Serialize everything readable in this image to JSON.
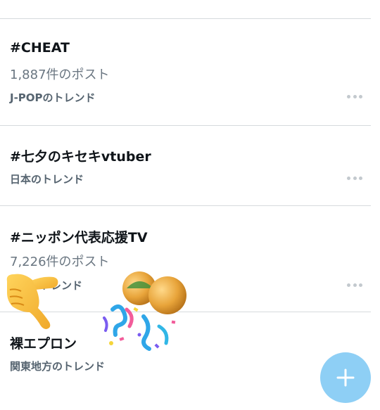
{
  "trends": [
    {
      "title": "#CHEAT",
      "count": "1,887件のポスト",
      "context": "J-POPのトレンド"
    },
    {
      "title": "#七夕のキセキvtuber",
      "count": "",
      "context": "日本のトレンド"
    },
    {
      "title": "#ニッポン代表応援TV",
      "count": "7,226件のポスト",
      "context": "トレンド"
    },
    {
      "title": "裸エプロン",
      "count": "",
      "context": "関東地方のトレンド"
    }
  ],
  "icons": {
    "more": "more-horizontal-icon",
    "compose": "plus-icon",
    "pointing_hand": "pointing-hand-emoji",
    "celebration": "celebration-sticker"
  },
  "colors": {
    "fab": "#8ecff5",
    "title": "#0f1419",
    "secondary": "#6a7681",
    "divider": "#d6dadd"
  }
}
